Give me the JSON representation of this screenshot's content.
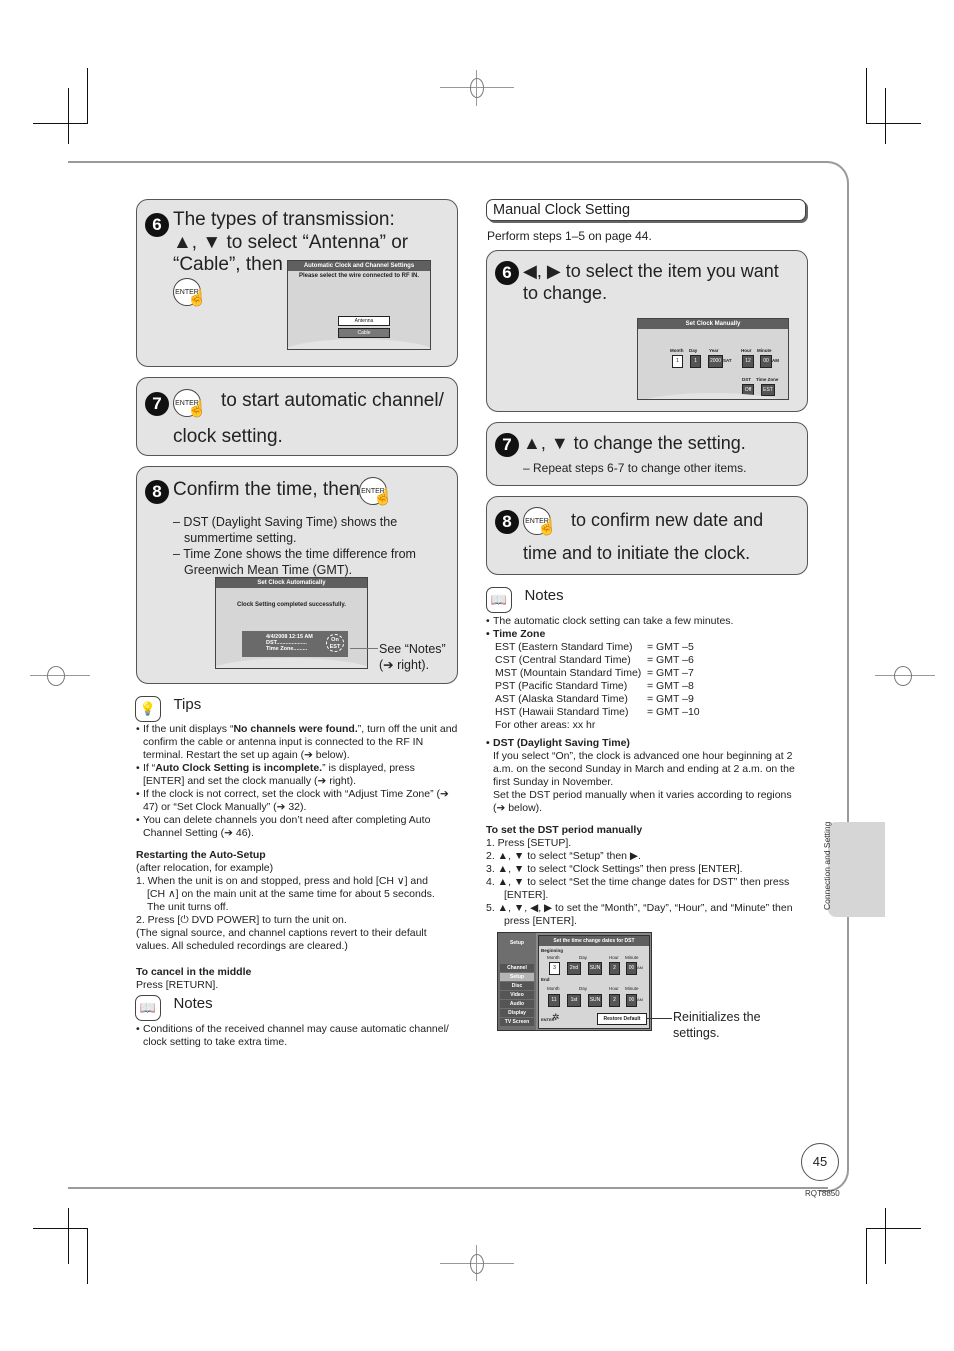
{
  "left": {
    "step6": {
      "num": "6",
      "line1": "The types of transmission:",
      "line2": "▲, ▼ to select “Antenna” or",
      "line3": "“Cable”, then",
      "enter": "ENTER",
      "osd": {
        "title": "Automatic Clock and Channel Settings",
        "message": "Please select the wire connected to RF IN.",
        "options": [
          "Antenna",
          "Cable"
        ],
        "selected": "Antenna"
      }
    },
    "step7": {
      "num": "7",
      "enter": "ENTER",
      "line1": "to start automatic channel/",
      "line2": "clock setting."
    },
    "step8": {
      "num": "8",
      "title": "Confirm the time, then",
      "enter": "ENTER",
      "bullets": [
        "– DST (Daylight Saving Time) shows the",
        "summertime setting.",
        "– Time Zone shows the time difference from",
        "Greenwich Mean Time (GMT)."
      ],
      "osd": {
        "title": "Set Clock Automatically",
        "message": "Clock Setting completed successfully.",
        "datetime": "4/4/2008 12:15 AM",
        "dst_label": "DST....................",
        "tz_label": "Time Zone.........",
        "dst_value": "On",
        "tz_value": "EST"
      },
      "callout1": "See “Notes”",
      "callout2": "(➔ right)."
    },
    "tips": {
      "heading": "Tips",
      "items": [
        {
          "pre": "If the unit displays “",
          "bold": "No channels were found.",
          "post": "”, turn off the unit and confirm the cable or antenna input is connected to the RF IN terminal. Restart the set up again (➔ below)."
        },
        {
          "pre": "If “",
          "bold": "Auto Clock Setting is incomplete.",
          "post": "” is displayed, press [ENTER] and set the clock manually (➔ right)."
        },
        {
          "pre": "If the clock is not correct, set the clock with “Adjust Time Zone” (➔ 47) or “Set Clock Manually” (➔ 32).",
          "bold": "",
          "post": ""
        },
        {
          "pre": "You can delete channels you don’t need after completing Auto Channel Setting (➔ 46).",
          "bold": "",
          "post": ""
        }
      ]
    },
    "restart": {
      "heading": "Restarting the Auto-Setup",
      "sub": "(after relocation, for example)",
      "lines": [
        "1. When the unit is on and stopped, press and hold [CH ∨] and",
        "[CH ∧] on the main unit at the same time for about 5 seconds.",
        "The unit turns off.",
        "2. Press [⏻ DVD POWER] to turn the unit on.",
        "(The signal source, and channel captions revert to their default",
        "values. All scheduled recordings are cleared.)"
      ]
    },
    "cancel": {
      "heading": "To cancel in the middle",
      "text": "Press [RETURN]."
    },
    "notes": {
      "heading": "Notes",
      "items": [
        "Conditions of the received channel may cause automatic channel/ clock setting to take extra time."
      ]
    }
  },
  "right": {
    "section_title": "Manual Clock Setting",
    "intro": "Perform steps 1–5 on page 44.",
    "step6": {
      "num": "6",
      "line1": "◀, ▶ to select the item you want",
      "line2": "to change.",
      "osd": {
        "title": "Set Clock Manually",
        "labels": [
          "Month",
          "Day",
          "Year",
          "Hour",
          "Minute"
        ],
        "month": "1",
        "day": "1",
        "year": "2000",
        "weekday": "SAT",
        "hour": "12",
        "minute": "00",
        "ampm": "AM",
        "dst_label": "DST",
        "tz_label": "Time Zone",
        "dst": "Off",
        "tz": "EST"
      }
    },
    "step7": {
      "num": "7",
      "title": "▲, ▼ to change the setting.",
      "sub": "– Repeat steps 6-7 to change other items."
    },
    "step8": {
      "num": "8",
      "enter": "ENTER",
      "line1": "to confirm new date and",
      "line2": "time and to initiate the clock."
    },
    "notes": {
      "heading": "Notes",
      "item1": "The automatic clock setting can take a few minutes.",
      "tz_heading": "Time Zone",
      "tz_rows": [
        {
          "name": "EST (Eastern Standard Time)",
          "value": "= GMT –5"
        },
        {
          "name": "CST (Central Standard Time)",
          "value": "= GMT –6"
        },
        {
          "name": "MST (Mountain Standard Time)",
          "value": "= GMT –7"
        },
        {
          "name": "PST (Pacific Standard Time)",
          "value": "= GMT –8"
        },
        {
          "name": "AST (Alaska Standard Time)",
          "value": "= GMT –9"
        },
        {
          "name": "HST (Hawaii Standard Time)",
          "value": "= GMT –10"
        }
      ],
      "tz_other": "For other areas: xx hr",
      "dst_heading": "DST (Daylight Saving Time)",
      "dst_text": "If you select “On”, the clock is advanced one hour beginning at 2 a.m. on the second Sunday in March and ending at 2 a.m. on the first Sunday in November.",
      "dst_text2": "Set the DST period manually when it varies according to regions (➔ below)."
    },
    "dst_manual": {
      "heading": "To set the DST period manually",
      "steps": [
        "1.  Press [SETUP].",
        "2.  ▲, ▼ to select “Setup” then ▶.",
        "3.  ▲, ▼ to select “Clock Settings” then press [ENTER].",
        "4.  ▲, ▼ to select “Set the time change dates for DST” then press [ENTER].",
        "5.  ▲, ▼, ◀, ▶ to set the “Month”, “Day”, “Hour”, and “Minute” then press [ENTER]."
      ]
    },
    "setup_osd": {
      "menu_title": "Setup",
      "menu": [
        "Channel",
        "Setup",
        "Disc",
        "Video",
        "Audio",
        "Display",
        "TV Screen"
      ],
      "active": "Setup",
      "title": "Set the time change dates for DST",
      "beginning": {
        "label": "Beginning",
        "month": "3",
        "week": "2nd",
        "weekday": "SUN",
        "hour": "2",
        "minute": "00",
        "ampm": "AM"
      },
      "end": {
        "label": "End",
        "month": "11",
        "week": "1st",
        "weekday": "SUN",
        "hour": "2",
        "minute": "00",
        "ampm": "AM"
      },
      "col_labels": [
        "Month",
        "Day",
        "Hour",
        "Minute"
      ],
      "enter": "ENTER",
      "restore": "Restore Default"
    },
    "callout": "Reinitializes the settings."
  },
  "side_tab": "Connection and Setting",
  "page_number": "45",
  "doc_code": "RQT8850"
}
